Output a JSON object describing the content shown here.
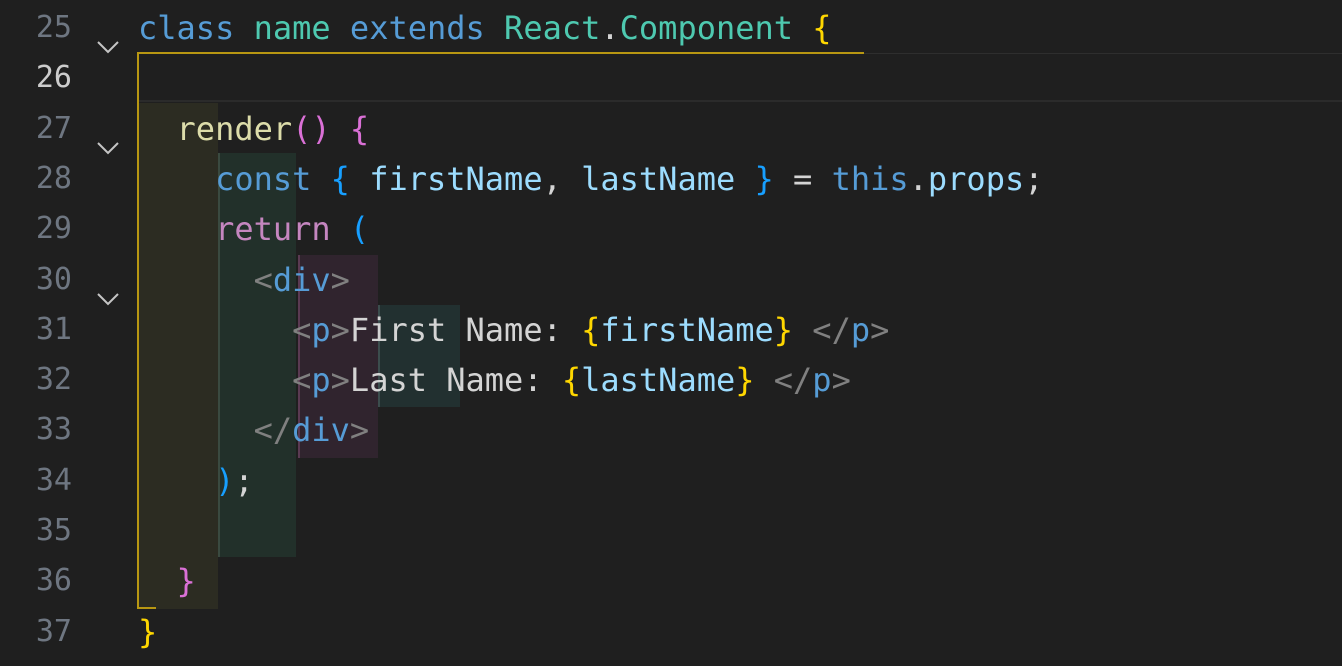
{
  "editor": {
    "active_line": "26",
    "lines": [
      {
        "num": "25",
        "tokens": [
          {
            "t": "class",
            "c": "kw"
          },
          {
            "t": " ",
            "c": "txt"
          },
          {
            "t": "name",
            "c": "cls"
          },
          {
            "t": " ",
            "c": "txt"
          },
          {
            "t": "extends",
            "c": "kw"
          },
          {
            "t": " ",
            "c": "txt"
          },
          {
            "t": "React",
            "c": "cls"
          },
          {
            "t": ".",
            "c": "txt"
          },
          {
            "t": "Component",
            "c": "cls"
          },
          {
            "t": " ",
            "c": "txt"
          },
          {
            "t": "{",
            "c": "b1"
          }
        ]
      },
      {
        "num": "26",
        "tokens": []
      },
      {
        "num": "27",
        "tokens": [
          {
            "t": "  ",
            "c": "txt"
          },
          {
            "t": "render",
            "c": "fn"
          },
          {
            "t": "()",
            "c": "b2"
          },
          {
            "t": " ",
            "c": "txt"
          },
          {
            "t": "{",
            "c": "b2"
          }
        ]
      },
      {
        "num": "28",
        "tokens": [
          {
            "t": "    ",
            "c": "txt"
          },
          {
            "t": "const",
            "c": "kw"
          },
          {
            "t": " ",
            "c": "txt"
          },
          {
            "t": "{",
            "c": "b3"
          },
          {
            "t": " ",
            "c": "txt"
          },
          {
            "t": "firstName",
            "c": "var"
          },
          {
            "t": ", ",
            "c": "txt"
          },
          {
            "t": "lastName",
            "c": "var"
          },
          {
            "t": " ",
            "c": "txt"
          },
          {
            "t": "}",
            "c": "b3"
          },
          {
            "t": " = ",
            "c": "txt"
          },
          {
            "t": "this",
            "c": "kw"
          },
          {
            "t": ".",
            "c": "txt"
          },
          {
            "t": "props",
            "c": "var"
          },
          {
            "t": ";",
            "c": "txt"
          }
        ]
      },
      {
        "num": "29",
        "tokens": [
          {
            "t": "    ",
            "c": "txt"
          },
          {
            "t": "return",
            "c": "ctrl"
          },
          {
            "t": " ",
            "c": "txt"
          },
          {
            "t": "(",
            "c": "b3"
          }
        ]
      },
      {
        "num": "30",
        "tokens": [
          {
            "t": "      ",
            "c": "txt"
          },
          {
            "t": "<",
            "c": "punct"
          },
          {
            "t": "div",
            "c": "tag"
          },
          {
            "t": ">",
            "c": "punct"
          }
        ]
      },
      {
        "num": "31",
        "tokens": [
          {
            "t": "        ",
            "c": "txt"
          },
          {
            "t": "<",
            "c": "punct"
          },
          {
            "t": "p",
            "c": "tag"
          },
          {
            "t": ">",
            "c": "punct"
          },
          {
            "t": "First Name: ",
            "c": "txt"
          },
          {
            "t": "{",
            "c": "b1"
          },
          {
            "t": "firstName",
            "c": "var"
          },
          {
            "t": "}",
            "c": "b1"
          },
          {
            "t": " ",
            "c": "txt"
          },
          {
            "t": "</",
            "c": "punct"
          },
          {
            "t": "p",
            "c": "tag"
          },
          {
            "t": ">",
            "c": "punct"
          }
        ]
      },
      {
        "num": "32",
        "tokens": [
          {
            "t": "        ",
            "c": "txt"
          },
          {
            "t": "<",
            "c": "punct"
          },
          {
            "t": "p",
            "c": "tag"
          },
          {
            "t": ">",
            "c": "punct"
          },
          {
            "t": "Last Name: ",
            "c": "txt"
          },
          {
            "t": "{",
            "c": "b1"
          },
          {
            "t": "lastName",
            "c": "var"
          },
          {
            "t": "}",
            "c": "b1"
          },
          {
            "t": " ",
            "c": "txt"
          },
          {
            "t": "</",
            "c": "punct"
          },
          {
            "t": "p",
            "c": "tag"
          },
          {
            "t": ">",
            "c": "punct"
          }
        ]
      },
      {
        "num": "33",
        "tokens": [
          {
            "t": "      ",
            "c": "txt"
          },
          {
            "t": "</",
            "c": "punct"
          },
          {
            "t": "div",
            "c": "tag"
          },
          {
            "t": ">",
            "c": "punct"
          }
        ]
      },
      {
        "num": "34",
        "tokens": [
          {
            "t": "    ",
            "c": "txt"
          },
          {
            "t": ")",
            "c": "b3"
          },
          {
            "t": ";",
            "c": "txt"
          }
        ]
      },
      {
        "num": "35",
        "tokens": []
      },
      {
        "num": "36",
        "tokens": [
          {
            "t": "  ",
            "c": "txt"
          },
          {
            "t": "}",
            "c": "b2"
          }
        ]
      },
      {
        "num": "37",
        "tokens": [
          {
            "t": "}",
            "c": "b1"
          }
        ]
      }
    ],
    "fold_icon": "chevron-down-icon",
    "fold_lines": [
      "25",
      "27",
      "30"
    ]
  }
}
